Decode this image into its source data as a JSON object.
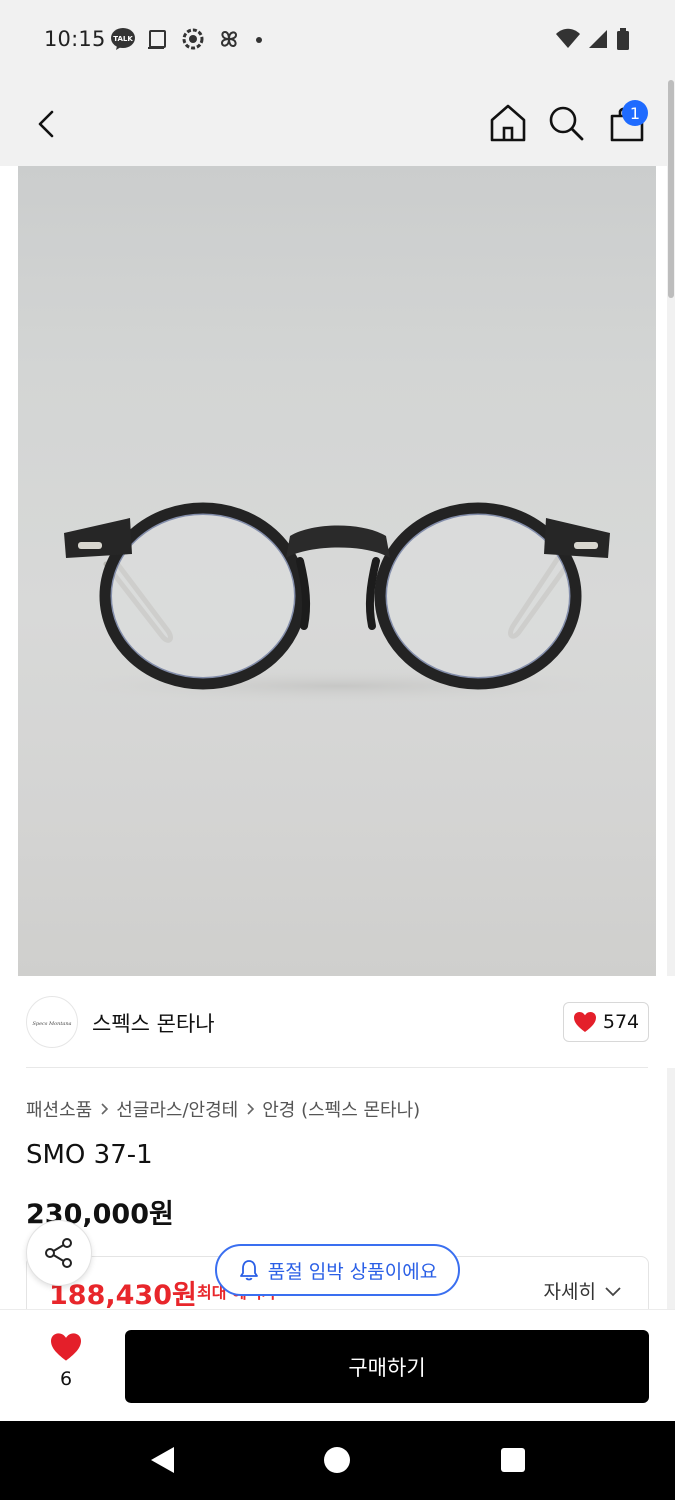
{
  "status_bar": {
    "time": "10:15",
    "left_icons": [
      "talk-icon",
      "square-icon",
      "settings-sync-icon",
      "pinwheel-icon",
      "dot-icon"
    ],
    "right_icons": [
      "wifi-icon",
      "signal-icon",
      "battery-icon"
    ],
    "talk_label": "TALK"
  },
  "nav": {
    "back_icon": "chevron-left-icon",
    "home_icon": "home-icon",
    "search_icon": "search-icon",
    "cart_icon": "shopping-bag-icon",
    "cart_badge": "1",
    "badge_color": "#1f6bff"
  },
  "product_image": {
    "subject": "round black acetate eyeglasses with silver temples"
  },
  "brand": {
    "name": "스펙스 몬타나",
    "logo_text": "Specs Montana",
    "likes": "574"
  },
  "breadcrumb": [
    "패션소품",
    "선글라스/안경테",
    "안경 (스펙스 몬타나)"
  ],
  "product": {
    "title": "SMO 37-1",
    "price": "230,000원",
    "discount_price": "188,430원",
    "discount_note": "최대 혜택가",
    "detail_label": "자세히",
    "discount_color": "#e8262b"
  },
  "floating": {
    "share_icon": "share-icon",
    "soldout_text": "품절 임박 상품이에요",
    "soldout_icon": "bell-icon"
  },
  "bottom_bar": {
    "wish_count": "6",
    "buy_label": "구매하기"
  },
  "android_nav": [
    "back-triangle-icon",
    "home-circle-icon",
    "recents-square-icon"
  ]
}
